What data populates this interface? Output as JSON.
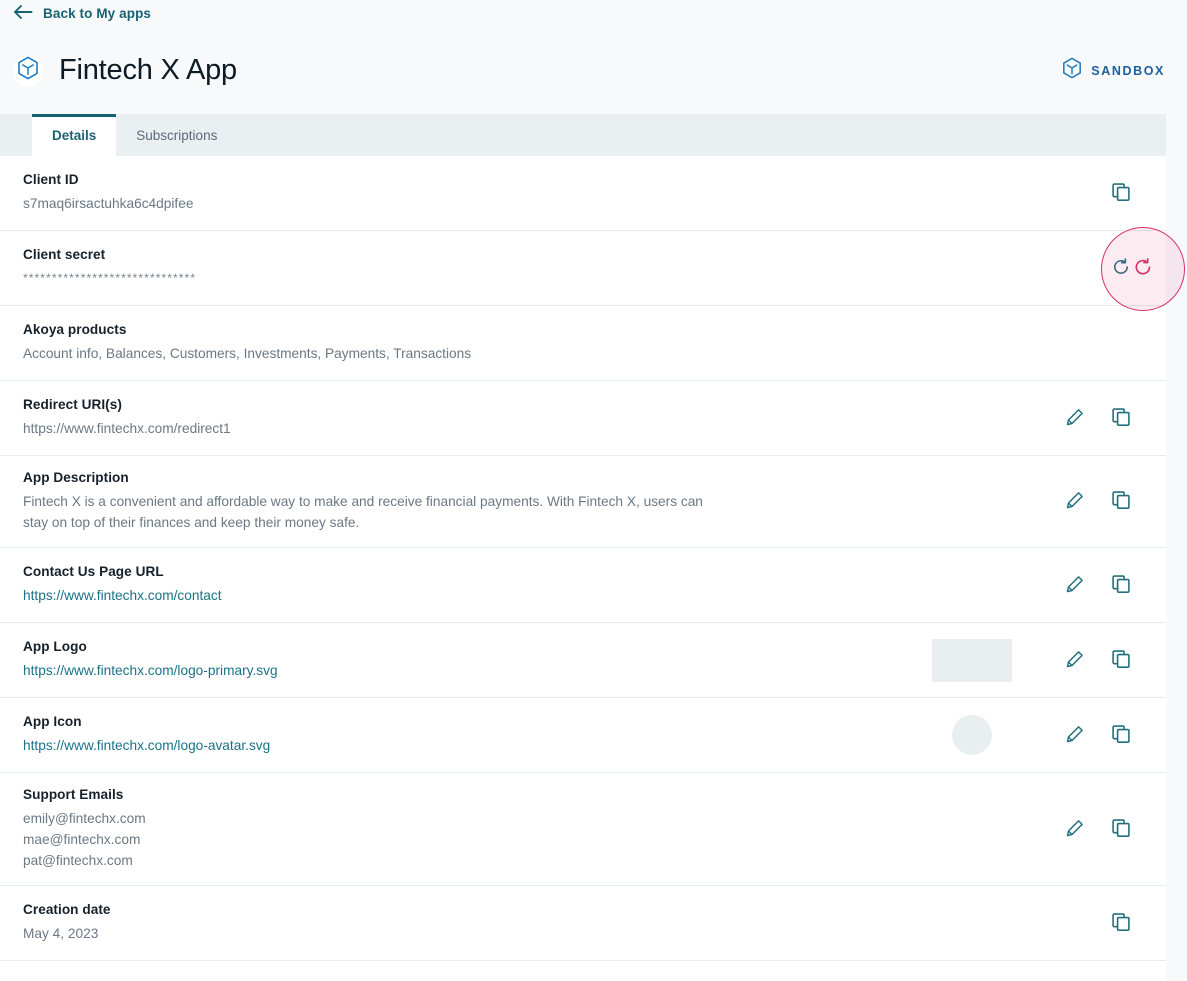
{
  "topbar": {
    "back_label": "Back to My apps",
    "back_icon": "arrow-left-icon"
  },
  "header": {
    "app_name": "Fintech X App",
    "avatar_icon": "akoya-hexagon-logo-icon",
    "environment_badge": {
      "label": "SANDBOX",
      "icon": "akoya-hexagon-logo-icon",
      "color": "#1c5f9e"
    }
  },
  "tabs": [
    {
      "label": "Details",
      "active": true
    },
    {
      "label": "Subscriptions",
      "active": false
    }
  ],
  "details": {
    "rows": [
      {
        "label": "Client ID",
        "value": "s7maq6irsactuhka6c4dpifee",
        "actions": [
          "copy-icon"
        ]
      },
      {
        "label": "Client secret",
        "value": "******************************",
        "actions": [
          "refresh-icon"
        ]
      },
      {
        "label": "Akoya products",
        "value": "Account info, Balances, Customers, Investments, Payments, Transactions",
        "actions": []
      },
      {
        "label": "Redirect URI(s)",
        "value": "https://www.fintechx.com/redirect1",
        "actions": [
          "edit-icon",
          "copy-icon"
        ]
      },
      {
        "label": "App Description",
        "value": "Fintech X is a convenient and affordable way to make and receive financial payments. With Fintech X, users can stay on top of their finances and keep their money safe.",
        "actions": [
          "edit-icon",
          "copy-icon"
        ]
      },
      {
        "label": "Contact Us Page URL",
        "link": "https://www.fintechx.com/contact",
        "actions": [
          "edit-icon",
          "copy-icon"
        ]
      },
      {
        "label": "App Logo",
        "link": "https://www.fintechx.com/logo-primary.svg",
        "preview": "rectangle-placeholder",
        "actions": [
          "edit-icon",
          "copy-icon"
        ]
      },
      {
        "label": "App Icon",
        "link": "https://www.fintechx.com/logo-avatar.svg",
        "preview": "circle-placeholder",
        "actions": [
          "edit-icon",
          "copy-icon"
        ]
      },
      {
        "label": "Support Emails",
        "emails": [
          "emily@fintechx.com",
          "mae@fintechx.com",
          "pat@fintechx.com"
        ],
        "actions": [
          "edit-icon",
          "copy-icon"
        ]
      },
      {
        "label": "Creation date",
        "value": "May 4, 2023",
        "actions": [
          "copy-icon"
        ]
      }
    ]
  },
  "annotation": {
    "target": "regenerate-client-secret-button",
    "icon": "refresh-icon",
    "accent": "#d6316a"
  },
  "colors": {
    "link": "#1a7286",
    "icon_teal": "#22707f",
    "tab_accent": "#12626f",
    "header_bg": "#f7f9fa",
    "tabstrip_bg": "#eaeff2",
    "placeholder": "#e9eef1"
  }
}
